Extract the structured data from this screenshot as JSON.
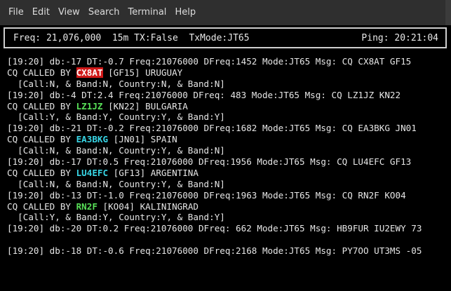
{
  "menu": [
    {
      "label": "File",
      "name": "menu-file"
    },
    {
      "label": "Edit",
      "name": "menu-edit"
    },
    {
      "label": "View",
      "name": "menu-view"
    },
    {
      "label": "Search",
      "name": "menu-search"
    },
    {
      "label": "Terminal",
      "name": "menu-terminal"
    },
    {
      "label": "Help",
      "name": "menu-help"
    }
  ],
  "status": {
    "left": "Freq: 21,076,000  15m TX:False  TxMode:JT65",
    "right": "Ping: 20:21:04"
  },
  "colors": {
    "red_badge": "#d01818",
    "green_call": "#58e058",
    "cyan_call": "#38d6e6"
  },
  "log": [
    {
      "type": "decode",
      "text": "[19:20] db:-17 DT:-0.7 Freq:21076000 DFreq:1452 Mode:JT65 Msg: CQ CX8AT GF15"
    },
    {
      "type": "called",
      "prefix": "CQ CALLED BY ",
      "call": "CX8AT",
      "style": "red",
      "suffix": " [GF15] URUGUAY"
    },
    {
      "type": "info",
      "text": "  [Call:N, & Band:N, Country:N, & Band:N]"
    },
    {
      "type": "decode",
      "text": "[19:20] db:-4 DT:2.4 Freq:21076000 DFreq: 483 Mode:JT65 Msg: CQ LZ1JZ KN22"
    },
    {
      "type": "called",
      "prefix": "CQ CALLED BY ",
      "call": "LZ1JZ",
      "style": "green",
      "suffix": " [KN22] BULGARIA"
    },
    {
      "type": "info",
      "text": "  [Call:Y, & Band:Y, Country:Y, & Band:Y]"
    },
    {
      "type": "decode",
      "text": "[19:20] db:-21 DT:-0.2 Freq:21076000 DFreq:1682 Mode:JT65 Msg: CQ EA3BKG JN01"
    },
    {
      "type": "called",
      "prefix": "CQ CALLED BY ",
      "call": "EA3BKG",
      "style": "cyan",
      "suffix": " [JN01] SPAIN"
    },
    {
      "type": "info",
      "text": "  [Call:N, & Band:N, Country:Y, & Band:N]"
    },
    {
      "type": "decode",
      "text": "[19:20] db:-17 DT:0.5 Freq:21076000 DFreq:1956 Mode:JT65 Msg: CQ LU4EFC GF13"
    },
    {
      "type": "called",
      "prefix": "CQ CALLED BY ",
      "call": "LU4EFC",
      "style": "cyan",
      "suffix": " [GF13] ARGENTINA"
    },
    {
      "type": "info",
      "text": "  [Call:N, & Band:N, Country:Y, & Band:N]"
    },
    {
      "type": "decode",
      "text": "[19:20] db:-13 DT:-1.0 Freq:21076000 DFreq:1963 Mode:JT65 Msg: CQ RN2F KO04"
    },
    {
      "type": "called",
      "prefix": "CQ CALLED BY ",
      "call": "RN2F",
      "style": "green",
      "suffix": " [KO04] KALININGRAD"
    },
    {
      "type": "info",
      "text": "  [Call:Y, & Band:Y, Country:Y, & Band:Y]"
    },
    {
      "type": "decode",
      "text": "[19:20] db:-20 DT:0.2 Freq:21076000 DFreq: 662 Mode:JT65 Msg: HB9FUR IU2EWY 73"
    },
    {
      "type": "blank"
    },
    {
      "type": "decode",
      "text": "[19:20] db:-18 DT:-0.6 Freq:21076000 DFreq:2168 Mode:JT65 Msg: PY7OO UT3MS -05"
    }
  ]
}
